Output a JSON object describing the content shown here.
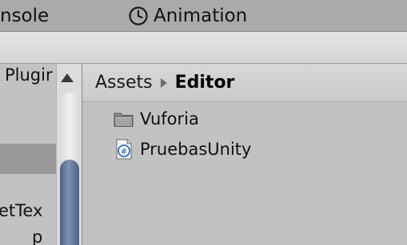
{
  "tabs": {
    "console_label": "nsole",
    "animation_label": "Animation"
  },
  "left_panel": {
    "items": [
      "Plugir",
      "etTex",
      "p"
    ]
  },
  "breadcrumb": {
    "items": [
      "Assets",
      "Editor"
    ]
  },
  "assets": [
    {
      "name": "Vuforia",
      "icon": "folder-icon"
    },
    {
      "name": "PruebasUnity",
      "icon": "csharp-script-icon"
    }
  ],
  "colors": {
    "scroll_thumb": "#6a7fa0",
    "panel_bg": "#c2c2c2"
  }
}
